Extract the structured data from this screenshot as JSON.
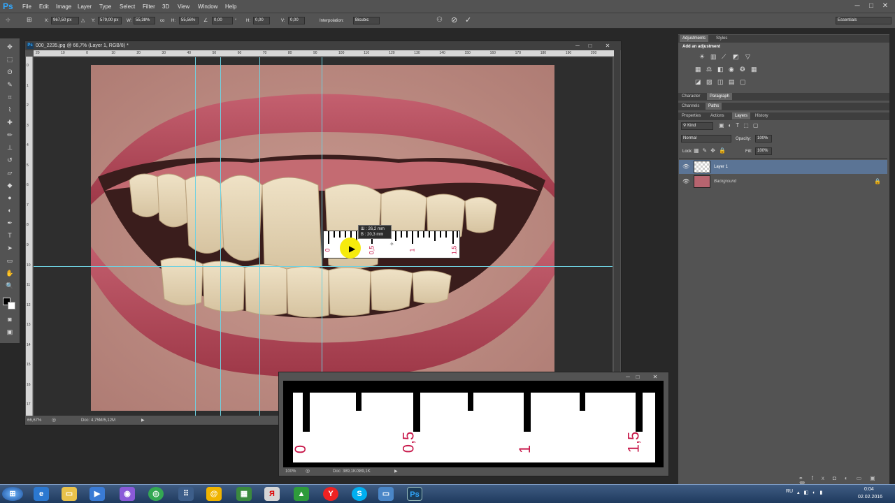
{
  "app": {
    "logo": "Ps"
  },
  "menu": [
    "File",
    "Edit",
    "Image",
    "Layer",
    "Type",
    "Select",
    "Filter",
    "3D",
    "View",
    "Window",
    "Help"
  ],
  "options_bar": {
    "x_label": "X:",
    "x_value": "967,50 px",
    "y_label": "Y:",
    "y_value": "579,00 px",
    "w_label": "W:",
    "w_value": "55,38%",
    "link_label": "co",
    "h_label": "H:",
    "h_value": "55,56%",
    "angle_value": "0,00",
    "degree": "°",
    "hskew_label": "H:",
    "hskew_value": "0,00",
    "vskew_label": "V:",
    "vskew_value": "0,00",
    "interp_label": "Interpolation:",
    "interp_value": "Bicubic",
    "workspace": "Essentials"
  },
  "document": {
    "title": "000_2235.jpg @ 66,7% (Layer 1, RGB/8) *",
    "zoom": "66,67%",
    "doc_info": "Doc: 4,75M/5,12M",
    "hruler_ticks": [
      "20",
      "10",
      "0",
      "10",
      "20",
      "30",
      "40",
      "50",
      "60",
      "70",
      "80",
      "90",
      "100",
      "110",
      "120",
      "130",
      "140",
      "150",
      "160",
      "170",
      "180",
      "190",
      "200"
    ],
    "vruler_ticks": [
      "0",
      "1",
      "2",
      "3",
      "4",
      "5",
      "6",
      "7",
      "8",
      "9",
      "10",
      "11",
      "12",
      "13",
      "14",
      "15",
      "16",
      "17"
    ],
    "transform_tooltip": {
      "w": "Ш : 26,2 mm",
      "h": "В : 20,3 mm"
    },
    "ruler_labels": [
      "0",
      "0,5",
      "1",
      "1,5"
    ]
  },
  "second_window": {
    "ruler_labels": [
      "0",
      "0,5",
      "1",
      "1,5"
    ],
    "zoom": "100%",
    "doc_info": "Doc: 389,1K/389,1K"
  },
  "panels": {
    "adjustments_tabs": [
      "Adjustments",
      "Styles"
    ],
    "add_adjustment": "Add an adjustment",
    "char_tabs": [
      "Character",
      "Paragraph"
    ],
    "channel_tabs": [
      "Channels",
      "Paths"
    ],
    "layer_tabs": [
      "Properties",
      "Actions",
      "Layers",
      "History"
    ],
    "kind_label": "Kind",
    "blend_mode": "Normal",
    "opacity_label": "Opacity:",
    "opacity_value": "100%",
    "lock_label": "Lock:",
    "fill_label": "Fill:",
    "fill_value": "100%",
    "layers": [
      {
        "name": "Layer 1",
        "selected": true
      },
      {
        "name": "Background",
        "selected": false,
        "locked": true
      }
    ]
  },
  "taskbar": {
    "lang": "RU",
    "time": "0:04",
    "date": "02.02.2016"
  },
  "colors": {
    "accent": "#31a8ff",
    "selected_layer": "#5b7495",
    "guide": "#6fd1e0",
    "ruler_mark": "#c8194b"
  }
}
